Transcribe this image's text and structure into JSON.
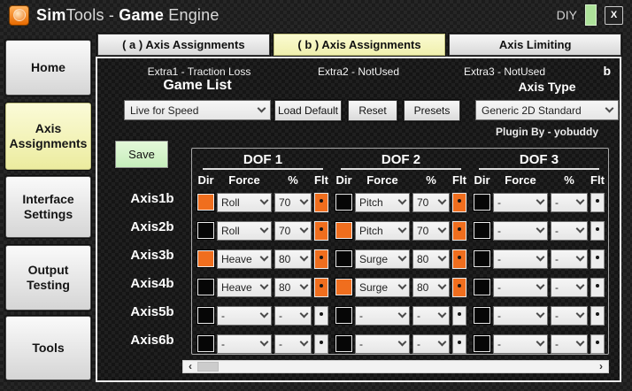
{
  "titlebar": {
    "title_bold1": "Sim",
    "title_rest1": "Tools - ",
    "title_bold2": "Game",
    "title_rest2": " Engine",
    "diy_label": "DIY",
    "close_glyph": "X"
  },
  "sidebar": {
    "items": [
      {
        "label": "Home",
        "active": false
      },
      {
        "label": "Axis Assignments",
        "active": true
      },
      {
        "label": "Interface Settings",
        "active": false
      },
      {
        "label": "Output Testing",
        "active": false
      },
      {
        "label": "Tools",
        "active": false
      }
    ]
  },
  "tabs": [
    {
      "label": "( a ) Axis Assignments",
      "active": false
    },
    {
      "label": "( b ) Axis Assignments",
      "active": true
    },
    {
      "label": "Axis Limiting",
      "active": false
    }
  ],
  "extras": {
    "extra1": "Extra1 - Traction Loss",
    "extra2": "Extra2 - NotUsed",
    "extra3": "Extra3 - NotUsed",
    "corner": "b"
  },
  "game_list": {
    "label": "Game List",
    "selected": "Live for Speed"
  },
  "buttons": {
    "load_default": "Load Default",
    "reset": "Reset",
    "presets": "Presets",
    "save": "Save"
  },
  "axis_type": {
    "label": "Axis Type",
    "selected": "Generic 2D Standard"
  },
  "plugin_by": "Plugin By - yobuddy",
  "axis_table": {
    "dof_headers": [
      "DOF 1",
      "DOF 2",
      "DOF 3"
    ],
    "column_headers": [
      "Dir",
      "Force",
      "%",
      "Flt"
    ],
    "rows": [
      {
        "label": "Axis1b",
        "cells": [
          {
            "dir": true,
            "force": "Roll",
            "pct": "70",
            "flt": "orange"
          },
          {
            "dir": false,
            "force": "Pitch",
            "pct": "70",
            "flt": "orange"
          },
          {
            "dir": false,
            "force": "-",
            "pct": "-",
            "flt": "plain"
          }
        ]
      },
      {
        "label": "Axis2b",
        "cells": [
          {
            "dir": false,
            "force": "Roll",
            "pct": "70",
            "flt": "orange"
          },
          {
            "dir": true,
            "force": "Pitch",
            "pct": "70",
            "flt": "orange"
          },
          {
            "dir": false,
            "force": "-",
            "pct": "-",
            "flt": "plain"
          }
        ]
      },
      {
        "label": "Axis3b",
        "cells": [
          {
            "dir": true,
            "force": "Heave",
            "pct": "80",
            "flt": "orange"
          },
          {
            "dir": false,
            "force": "Surge",
            "pct": "80",
            "flt": "orange"
          },
          {
            "dir": false,
            "force": "-",
            "pct": "-",
            "flt": "plain"
          }
        ]
      },
      {
        "label": "Axis4b",
        "cells": [
          {
            "dir": false,
            "force": "Heave",
            "pct": "80",
            "flt": "orange"
          },
          {
            "dir": true,
            "force": "Surge",
            "pct": "80",
            "flt": "orange"
          },
          {
            "dir": false,
            "force": "-",
            "pct": "-",
            "flt": "plain"
          }
        ]
      },
      {
        "label": "Axis5b",
        "cells": [
          {
            "dir": false,
            "force": "-",
            "pct": "-",
            "flt": "plain"
          },
          {
            "dir": false,
            "force": "-",
            "pct": "-",
            "flt": "plain"
          },
          {
            "dir": false,
            "force": "-",
            "pct": "-",
            "flt": "plain"
          }
        ]
      },
      {
        "label": "Axis6b",
        "cells": [
          {
            "dir": false,
            "force": "-",
            "pct": "-",
            "flt": "plain"
          },
          {
            "dir": false,
            "force": "-",
            "pct": "-",
            "flt": "plain"
          },
          {
            "dir": false,
            "force": "-",
            "pct": "-",
            "flt": "plain"
          }
        ]
      }
    ]
  },
  "scrollbar": {
    "left_arrow": "‹",
    "right_arrow": "›"
  },
  "colors": {
    "accent_orange": "#F06E1E",
    "active_yellow": "#F6F6C2",
    "save_green": "#CFF2C5",
    "titlebar_green": "#ADE29A"
  }
}
